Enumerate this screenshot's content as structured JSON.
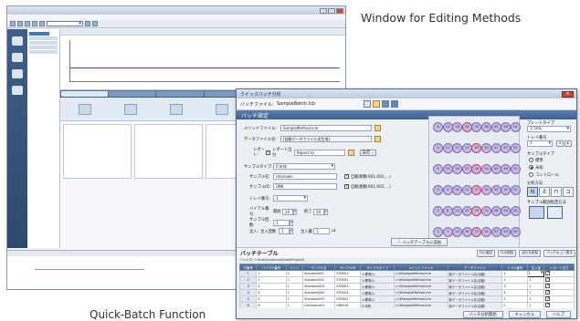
{
  "captions": {
    "top": "Window for Editing Methods",
    "bottom": "Quick-Batch Function"
  },
  "front": {
    "window_title": "クイックバッチ分析",
    "batch_file_label": "バッチファイル:",
    "batch_file_value": "SampleBatch.lcb",
    "section_title": "バッチ設定",
    "method_file_label": "メソッドファイル:",
    "method_file_value": "SampleMethod.lcm",
    "data_file_label": "データファイル名:",
    "data_file_value": "(自動データファイル名生成)",
    "report_label": "レポート:",
    "report_checkbox": "レポート出力",
    "report_value": "Report.lsr",
    "settings_button": "設定...",
    "sample_type_label": "サンプルタイプ:",
    "sample_type_value": "0:未知",
    "sample_name_label": "サンプル名:",
    "sample_name_value": "Unknown",
    "auto_increment": "自動連番(001,002,...)",
    "sample_id_label": "サンプルID:",
    "sample_id_value": "UNK",
    "tray_label": "トレイ番号:",
    "tray_value": "1",
    "vial_label": "バイアル番号:",
    "start_label": "開始",
    "start_value": "24",
    "end_label": "終了",
    "end_value": "29",
    "injection_count_label": "サンプル回数:",
    "injection_count_value": "1",
    "inject_label": "注入:",
    "inject_count_label": "注入回数",
    "inject_count_value": "1",
    "inject_volume_label": "注入量",
    "inject_volume_value": "1",
    "inject_unit": "uL",
    "add_button": "バッチテーブルに追加",
    "plate_type_label": "プレートタイプ",
    "plate_type_value": "1.5mL",
    "tray_no_label": "トレイ番号",
    "tray_no_value": "1",
    "sample_type_right_label": "サンプルタイプ",
    "radio_standard": "標準",
    "radio_unknown": "未知",
    "radio_control": "コントロール",
    "analysis_order_label": "分析方向",
    "vial_select_label": "サンプル範囲指定方法",
    "vials": [
      [
        "6",
        "12",
        "18",
        "24",
        "30",
        "36",
        "42",
        "48",
        "54"
      ],
      [
        "5",
        "11",
        "17",
        "23",
        "29",
        "35",
        "41",
        "47",
        "53"
      ],
      [
        "4",
        "10",
        "16",
        "22",
        "28",
        "34",
        "40",
        "46",
        "52"
      ],
      [
        "3",
        "9",
        "15",
        "21",
        "27",
        "33",
        "39",
        "45",
        "51"
      ],
      [
        "2",
        "8",
        "14",
        "20",
        "26",
        "32",
        "38",
        "44",
        "50"
      ],
      [
        "1",
        "7",
        "13",
        "19",
        "25",
        "31",
        "37",
        "43",
        "49"
      ]
    ],
    "table_title": "バッチテーブル",
    "table_buttons": [
      "行の追加",
      "行の削除",
      "全行を削除",
      "バッチキュー表示"
    ],
    "folder_label": "フォルダ: C:¥LabSolutions¥Data¥Project1",
    "columns": [
      "行番号",
      "バイアル番号",
      "トレイ",
      "サンプル名",
      "サンプルID",
      "サンプルタイプ",
      "メソッドファイル",
      "データファイル",
      "レベル番号",
      "注入量",
      "レポート出力"
    ],
    "rows": [
      [
        "1",
        "1",
        "1",
        "Standard001",
        "STD001",
        "1:標準(I)",
        "c:\\¥SampleMethod.lcm",
        "新データファイル名(自動)",
        "1",
        "1",
        ""
      ],
      [
        "2",
        "2",
        "1",
        "Standard002",
        "STD002",
        "1:標準(I)",
        "c:\\¥SampleMethod.lcm",
        "新データファイル名(自動)",
        "2",
        "1",
        ""
      ],
      [
        "3",
        "3",
        "1",
        "Standard003",
        "STD003",
        "1:標準(I)",
        "c:\\¥SampleMethod.lcm",
        "新データファイル名(自動)",
        "3",
        "1",
        ""
      ],
      [
        "4",
        "4",
        "1",
        "Standard004",
        "STD004",
        "1:標準(I)",
        "c:\\¥SampleMethod.lcm",
        "新データファイル名(自動)",
        "4",
        "1",
        ""
      ],
      [
        "5",
        "5",
        "1",
        "Standard005",
        "STD005",
        "1:標準(I)",
        "c:\\¥SampleMethod.lcm",
        "新データファイル名(自動)",
        "5",
        "1",
        ""
      ],
      [
        "6",
        "6",
        "1",
        "Unknown001",
        "UNK001",
        "0:未知",
        "c:\\¥SampleMethod.lcm",
        "新データファイル名(自動)",
        "0",
        "1",
        ""
      ],
      [
        "7",
        "7",
        "1",
        "Unknown002",
        "UNK002",
        "0:未知",
        "c:\\¥SampleMethod.lcm",
        "新データファイル名(自動)",
        "0",
        "1",
        ""
      ]
    ],
    "bottom_buttons": [
      "バッチ分析開始",
      "キャンセル",
      "ヘルプ"
    ]
  }
}
